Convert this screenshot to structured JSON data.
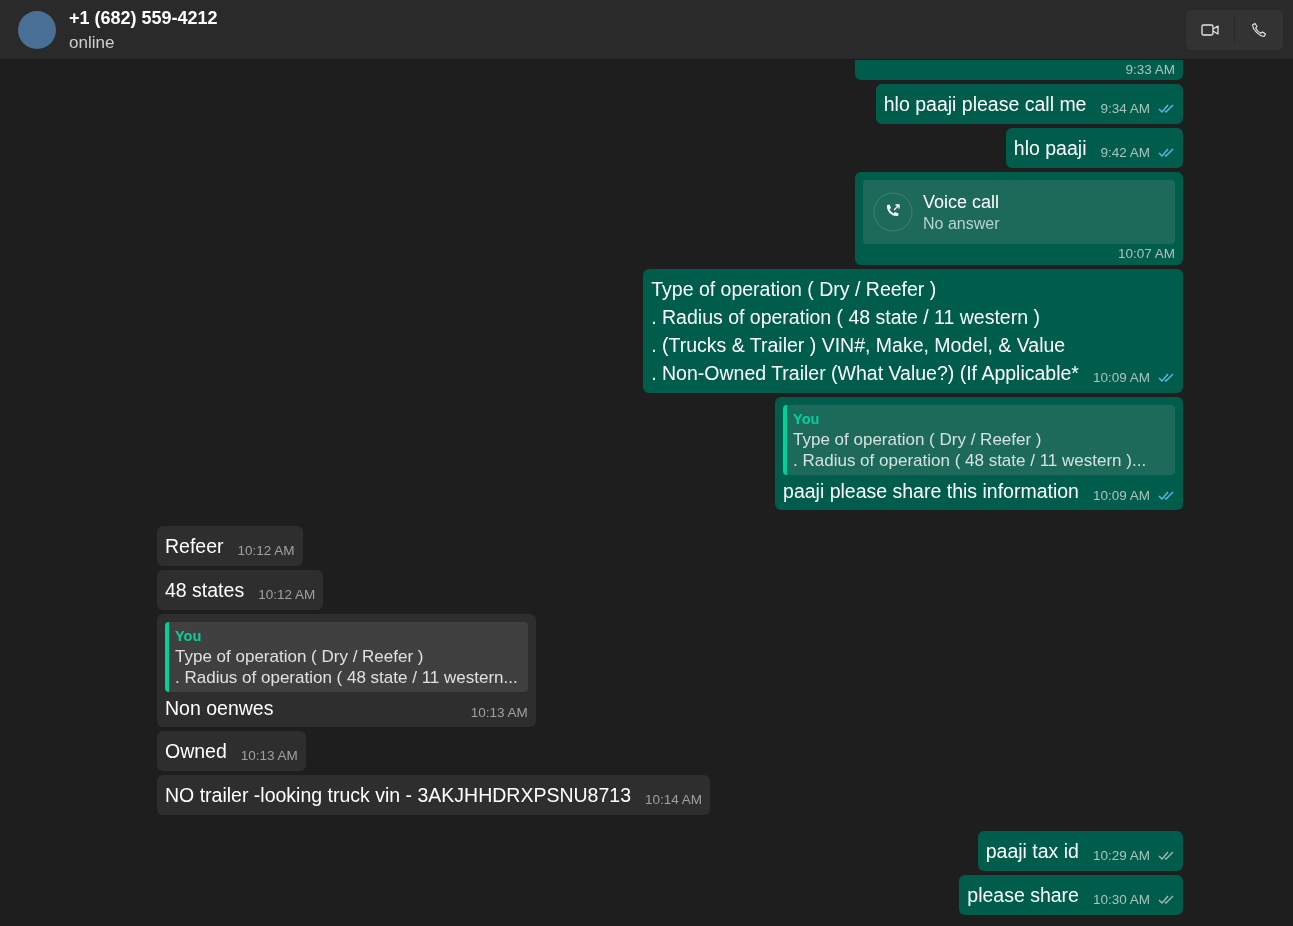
{
  "header": {
    "name": "+1 (682) 559-4212",
    "status": "online"
  },
  "messages": [
    {
      "outgoing": true,
      "kind": "cut",
      "time": "9:33 AM"
    },
    {
      "outgoing": true,
      "kind": "text",
      "text": "hlo paaji please call me",
      "time": "9:34 AM",
      "read": true
    },
    {
      "outgoing": true,
      "kind": "text",
      "text": "hlo paaji",
      "time": "9:42 AM",
      "read": true
    },
    {
      "outgoing": true,
      "kind": "call",
      "title": "Voice call",
      "subtitle": "No answer",
      "time": "10:07 AM"
    },
    {
      "outgoing": true,
      "kind": "text",
      "text": "Type of operation ( Dry / Reefer )\n. Radius of operation ( 48 state / 11 western )\n. (Trucks & Trailer ) VIN#, Make, Model, & Value\n. Non-Owned Trailer (What Value?) (If Applicable*",
      "time": "10:09 AM",
      "read": true
    },
    {
      "outgoing": true,
      "kind": "reply",
      "quote": {
        "author": "You",
        "lines": [
          "Type of operation ( Dry / Reefer )",
          ". Radius of operation ( 48 state / 11 western )..."
        ]
      },
      "text": "paaji please share this information",
      "time": "10:09 AM",
      "read": true
    },
    {
      "outgoing": false,
      "kind": "text",
      "text": "Refeer",
      "time": "10:12 AM"
    },
    {
      "outgoing": false,
      "kind": "text",
      "text": "48 states",
      "time": "10:12 AM"
    },
    {
      "outgoing": false,
      "kind": "reply",
      "quote": {
        "author": "You",
        "lines": [
          "Type of operation ( Dry / Reefer )",
          ". Radius of operation ( 48 state / 11 western..."
        ]
      },
      "text": "Non oenwes",
      "time": "10:13 AM"
    },
    {
      "outgoing": false,
      "kind": "text",
      "text": "Owned",
      "time": "10:13 AM"
    },
    {
      "outgoing": false,
      "kind": "text",
      "text": "NO trailer -looking truck vin - 3AKJHHDRXPSNU8713",
      "time": "10:14 AM"
    },
    {
      "outgoing": true,
      "kind": "text",
      "text": "paaji tax id",
      "time": "10:29 AM",
      "read": false
    },
    {
      "outgoing": true,
      "kind": "text",
      "text": "please share",
      "time": "10:30 AM",
      "read": false
    }
  ]
}
